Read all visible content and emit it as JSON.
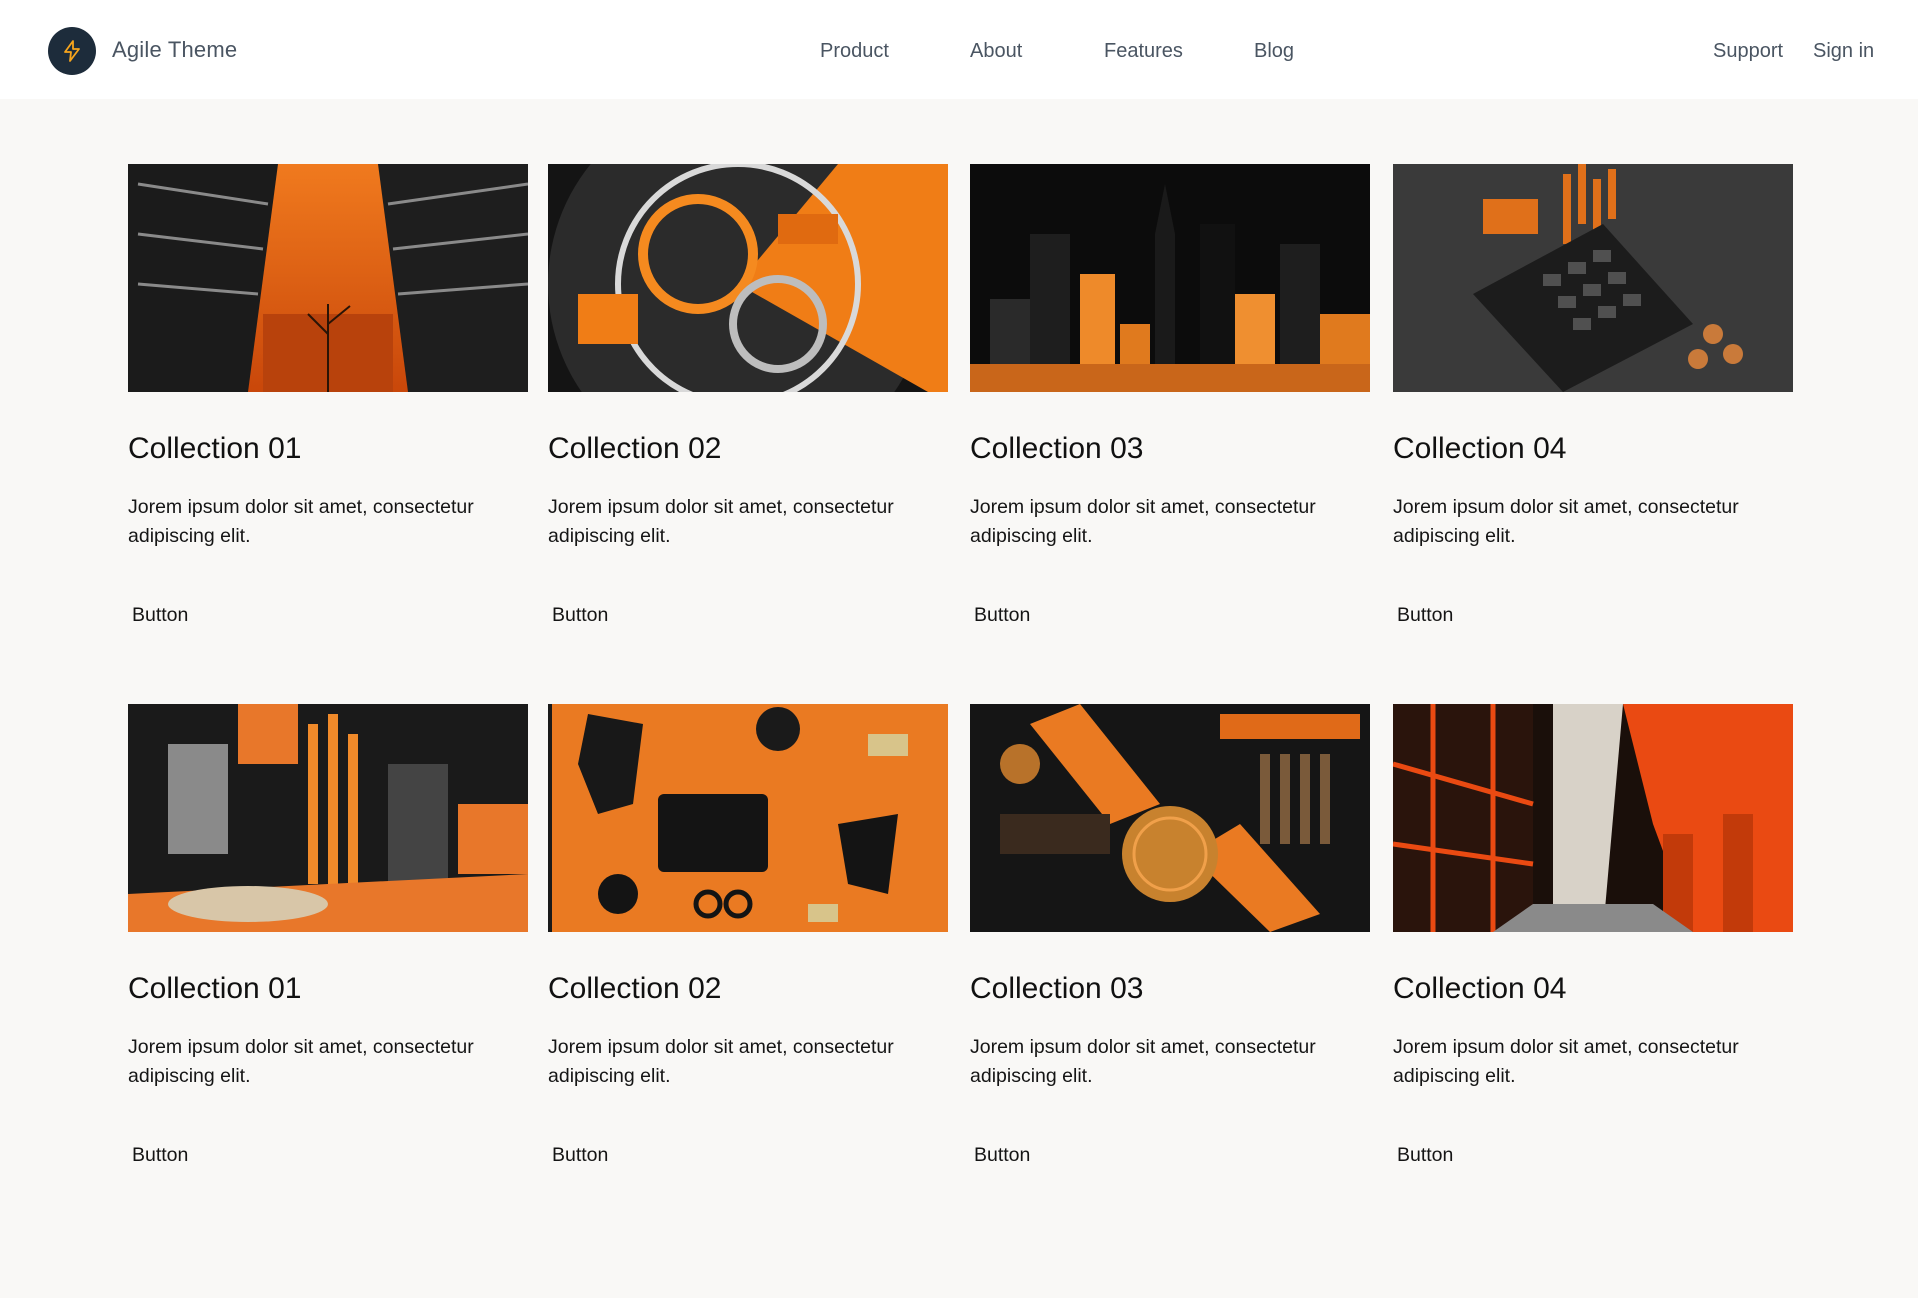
{
  "header": {
    "brand": "Agile Theme",
    "nav": [
      "Product",
      "About",
      "Features",
      "Blog"
    ],
    "support": "Support",
    "signin": "Sign in",
    "logo_color": "#1d2c3b",
    "accent": "#f7a51c"
  },
  "cards": [
    {
      "title": "Collection 01",
      "text": "Jorem ipsum dolor sit amet, consectetur adipiscing elit.",
      "button": "Button"
    },
    {
      "title": "Collection 02",
      "text": "Jorem ipsum dolor sit amet, consectetur adipiscing elit.",
      "button": "Button"
    },
    {
      "title": "Collection 03",
      "text": "Jorem ipsum dolor sit amet, consectetur adipiscing elit.",
      "button": "Button"
    },
    {
      "title": "Collection 04",
      "text": "Jorem ipsum dolor sit amet, consectetur adipiscing elit.",
      "button": "Button"
    },
    {
      "title": "Collection 01",
      "text": "Jorem ipsum dolor sit amet, consectetur adipiscing elit.",
      "button": "Button"
    },
    {
      "title": "Collection 02",
      "text": "Jorem ipsum dolor sit amet, consectetur adipiscing elit.",
      "button": "Button"
    },
    {
      "title": "Collection 03",
      "text": "Jorem ipsum dolor sit amet, consectetur adipiscing elit.",
      "button": "Button"
    },
    {
      "title": "Collection 04",
      "text": "Jorem ipsum dolor sit amet, consectetur adipiscing elit.",
      "button": "Button"
    }
  ]
}
